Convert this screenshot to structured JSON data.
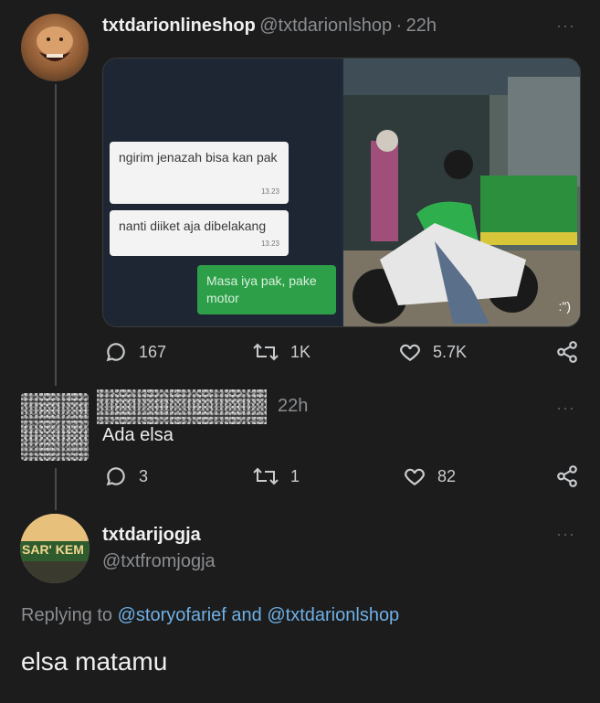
{
  "tweet1": {
    "display_name": "txtdarionlineshop",
    "handle": "@txtdarionlshop",
    "separator": "·",
    "time": "22h",
    "more": "···",
    "media": {
      "chat": [
        {
          "text": "ngirim jenazah bisa kan pak",
          "time": "13.23"
        },
        {
          "text": "nanti diiket aja dibelakang",
          "time": "13.23"
        },
        {
          "text": "Masa iya pak, pake motor"
        }
      ],
      "sticker": ":\")"
    },
    "actions": {
      "replies": "167",
      "retweets": "1K",
      "likes": "5.7K"
    }
  },
  "tweet2": {
    "time": "22h",
    "more": "···",
    "text": "Ada elsa",
    "actions": {
      "replies": "3",
      "retweets": "1",
      "likes": "82"
    }
  },
  "tweet3": {
    "display_name": "txtdarijogja",
    "handle": "@txtfromjogja",
    "more": "···",
    "avatar_text": "SAR' KEM",
    "replying_prefix": "Replying to",
    "replying_user1": "@storyofarief",
    "replying_and": "and",
    "replying_user2": "@txtdarionlshop",
    "text": "elsa matamu"
  },
  "colors": {
    "background": "#1c1c1c",
    "link": "#6fb0e6",
    "muted": "#8a8d91"
  }
}
